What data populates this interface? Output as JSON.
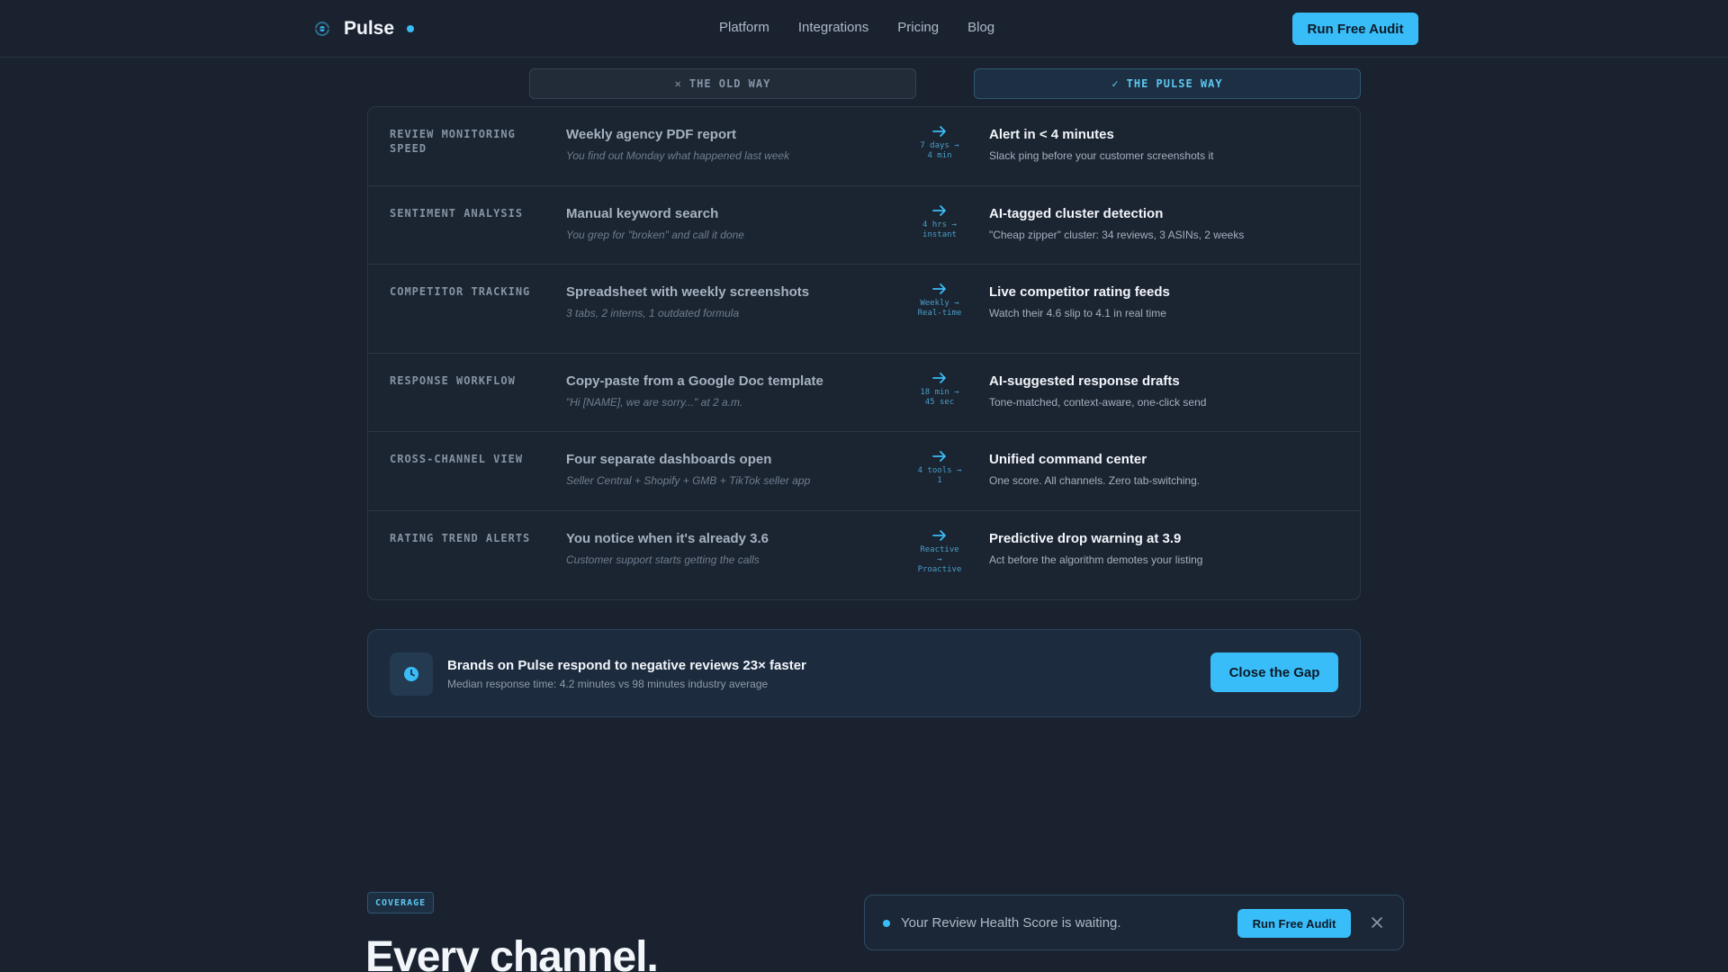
{
  "nav": {
    "brand": "Pulse",
    "links": [
      "Platform",
      "Integrations",
      "Pricing",
      "Blog"
    ],
    "cta": "Run Free Audit"
  },
  "comparison": {
    "old_header": "THE OLD WAY",
    "old_header_icon": "x-icon",
    "pulse_header": "THE PULSE WAY",
    "pulse_header_icon": "check-icon",
    "rows": [
      {
        "label": "REVIEW MONITORING SPEED",
        "old_title": "Weekly agency PDF report",
        "old_sub": "You find out Monday what happened last week",
        "delta": "7 days → 4 min",
        "new_title": "Alert in < 4 minutes",
        "new_sub": "Slack ping before your customer screenshots it"
      },
      {
        "label": "SENTIMENT ANALYSIS",
        "old_title": "Manual keyword search",
        "old_sub": "You grep for \"broken\" and call it done",
        "delta": "4 hrs → instant",
        "new_title": "AI-tagged cluster detection",
        "new_sub": "\"Cheap zipper\" cluster: 34 reviews, 3 ASINs, 2 weeks"
      },
      {
        "label": "COMPETITOR TRACKING",
        "old_title": "Spreadsheet with weekly screenshots",
        "old_sub": "3 tabs, 2 interns, 1 outdated formula",
        "delta": "Weekly → Real-time",
        "new_title": "Live competitor rating feeds",
        "new_sub": "Watch their 4.6 slip to 4.1 in real time"
      },
      {
        "label": "RESPONSE WORKFLOW",
        "old_title": "Copy-paste from a Google Doc template",
        "old_sub": "\"Hi [NAME], we are sorry...\" at 2 a.m.",
        "delta": "18 min → 45 sec",
        "new_title": "AI-suggested response drafts",
        "new_sub": "Tone-matched, context-aware, one-click send"
      },
      {
        "label": "CROSS-CHANNEL VIEW",
        "old_title": "Four separate dashboards open",
        "old_sub": "Seller Central + Shopify + GMB + TikTok seller app",
        "delta": "4 tools → 1",
        "new_title": "Unified command center",
        "new_sub": "One score. All channels. Zero tab-switching."
      },
      {
        "label": "RATING TREND ALERTS",
        "old_title": "You notice when it's already 3.6",
        "old_sub": "Customer support starts getting the calls",
        "delta": "Reactive → Proactive",
        "new_title": "Predictive drop warning at 3.9",
        "new_sub": "Act before the algorithm demotes your listing"
      }
    ]
  },
  "band": {
    "icon": "clock-icon",
    "title": "Brands on Pulse respond to negative reviews 23× faster",
    "subtitle": "Median response time: 4.2 minutes vs 98 minutes industry average",
    "cta": "Close the Gap"
  },
  "coverage": {
    "badge": "COVERAGE",
    "heading": "Every channel."
  },
  "toast": {
    "text": "Your Review Health Score is waiting.",
    "cta": "Run Free Audit",
    "close_icon": "close-icon"
  },
  "colors": {
    "accent": "#38bdf8",
    "background": "#1a2230"
  }
}
